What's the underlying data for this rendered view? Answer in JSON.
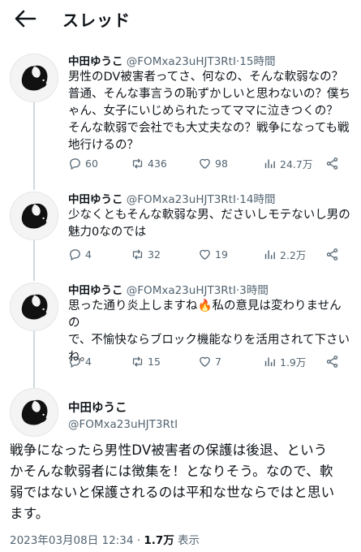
{
  "header": {
    "title": "スレッド"
  },
  "replies": [
    {
      "name": "中田ゆうこ",
      "handle": "@FOMxa23uHJT3RtI",
      "time": "15時間",
      "lines": [
        "男性のDV被害者ってさ、何なの、そんな軟弱なの？",
        "普通、そんな事言うの恥ずかしいと思わないの？僕ち",
        "ゃん、女子にいじめられたってママに泣きつくの？",
        "そんな軟弱で会社でも大丈夫なの？戦争になっても戦",
        "地行けるの？"
      ],
      "replies_count": "60",
      "retweets": "436",
      "likes": "98",
      "views": "24.7万"
    },
    {
      "name": "中田ゆうこ",
      "handle": "@FOMxa23uHJT3RtI",
      "time": "14時間",
      "lines": [
        "少なくともそんな軟弱な男、ださいしモテないし男の",
        "魅力0なのでは"
      ],
      "replies_count": "4",
      "retweets": "32",
      "likes": "19",
      "views": "2.2万"
    },
    {
      "name": "中田ゆうこ",
      "handle": "@FOMxa23uHJT3RtI",
      "time": "3時間",
      "lines": [
        "思った通り炎上しますね🔥私の意見は変わりませんの",
        "で、不愉快ならブロック機能なりを活用されて下さい",
        "ね。"
      ],
      "replies_count": "4",
      "retweets": "15",
      "likes": "7",
      "views": "1.9万"
    }
  ],
  "main": {
    "name": "中田ゆうこ",
    "handle": "@FOMxa23uHJT3RtI",
    "lines": [
      "戦争になったら男性DV被害者の保護は後退、という",
      "かそんな軟弱者には徴集を！となりそう。なので、軟",
      "弱ではないと保護されるのは平和な世ならではと思い",
      "ます。"
    ],
    "datetime": "2023年03月08日 12:34",
    "views": "1.7万",
    "views_label": "表示"
  },
  "icons": {
    "back": "arrow-left-icon",
    "reply": "reply-icon",
    "retweet": "retweet-icon",
    "like": "heart-icon",
    "views": "analytics-icon",
    "share": "share-icon",
    "avatar": "squirrel-icon"
  }
}
